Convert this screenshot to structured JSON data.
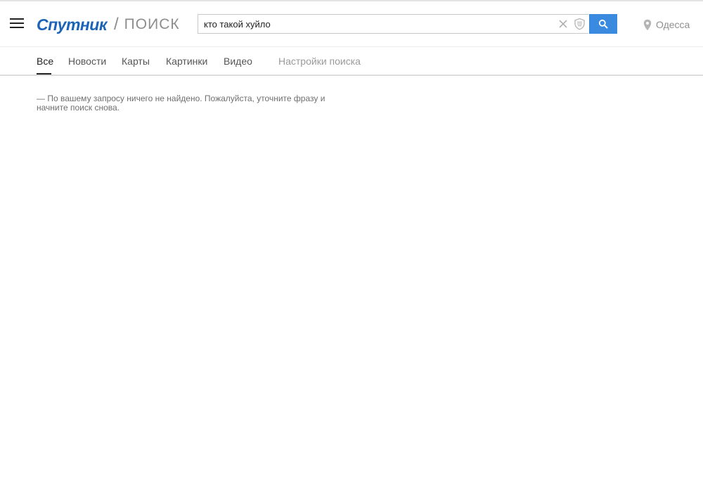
{
  "header": {
    "menu_icon": "hamburger-menu-icon",
    "logo": {
      "brand": "Спутник",
      "separator": "/",
      "section": "ПОИСК"
    },
    "search": {
      "value": "кто такой хуйло",
      "clear_icon": "close-icon",
      "shield_icon": "shield-icon",
      "button_icon": "search-icon"
    },
    "location": {
      "icon": "map-pin-icon",
      "label": "Одесса"
    }
  },
  "nav": {
    "tabs": [
      {
        "label": "Все",
        "active": true
      },
      {
        "label": "Новости",
        "active": false
      },
      {
        "label": "Карты",
        "active": false
      },
      {
        "label": "Картинки",
        "active": false
      },
      {
        "label": "Видео",
        "active": false
      }
    ],
    "settings_label": "Настройки поиска"
  },
  "results": {
    "message": "—  По вашему запросу ничего не найдено. Пожалуйста, уточните фразу и начните поиск снова."
  },
  "colors": {
    "brand": "#1b64b8",
    "search_button": "#3a8be0",
    "muted_text": "#8f8f8f"
  }
}
